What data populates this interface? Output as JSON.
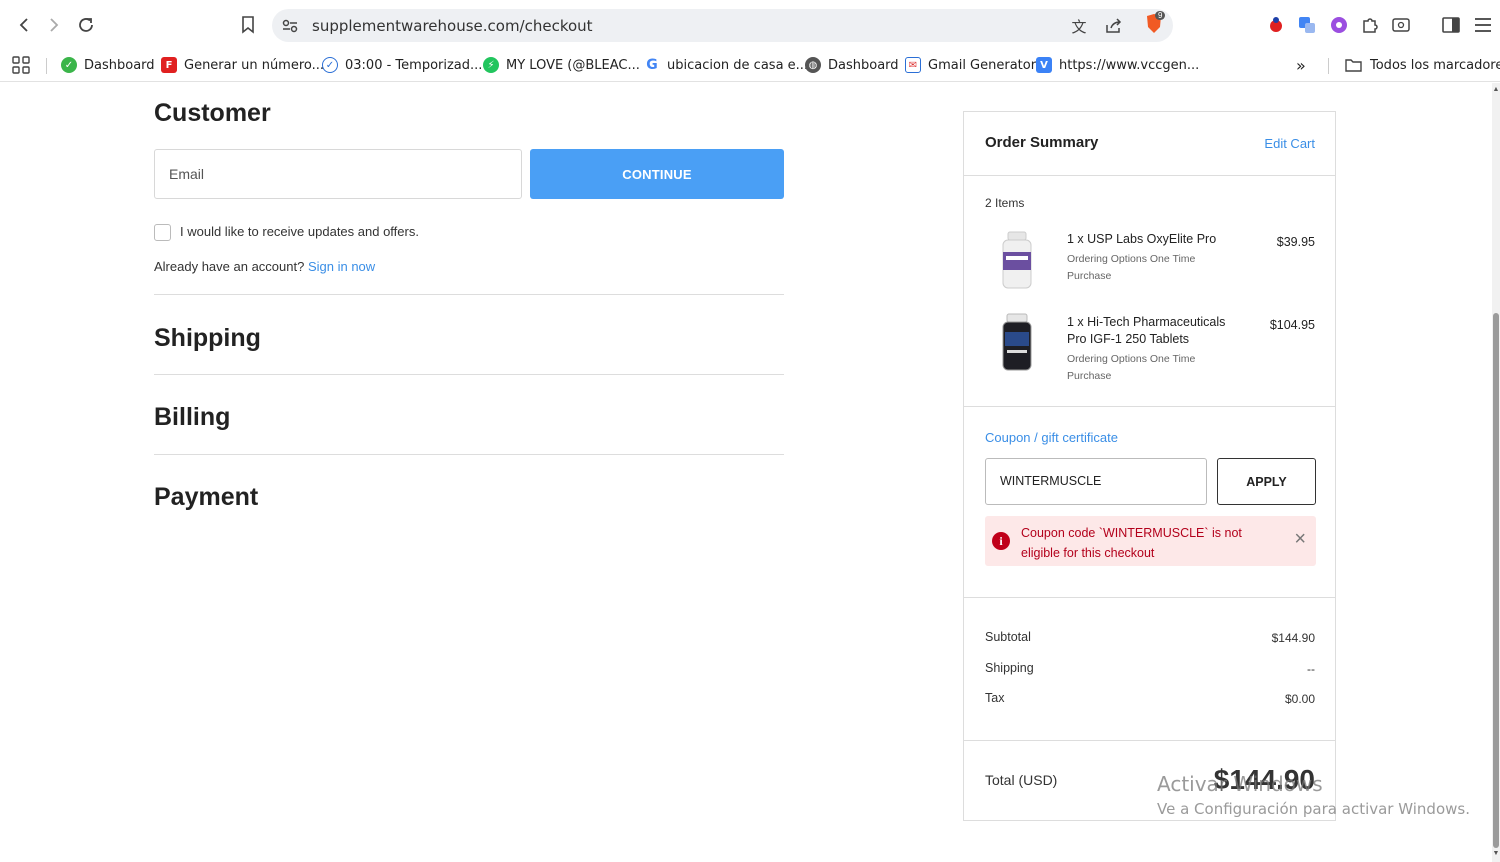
{
  "browser": {
    "url": "supplementwarehouse.com/checkout",
    "bookmarks": [
      {
        "label": "Dashboard",
        "icon": "leaf-icon",
        "color": "#3bb54a"
      },
      {
        "label": "Generar un número...",
        "icon": "f-icon",
        "color": "#e02020"
      },
      {
        "label": "03:00 - Temporizad...",
        "icon": "check-circle-icon",
        "color": "#2b6fd6"
      },
      {
        "label": "MY LOVE (@BLEAC...",
        "icon": "bolt-icon",
        "color": "#22c55e"
      },
      {
        "label": "ubicacion de casa e...",
        "icon": "google-icon",
        "color": "#4285f4"
      },
      {
        "label": "Dashboard",
        "icon": "globe-icon",
        "color": "#555555"
      },
      {
        "label": "Gmail Generator",
        "icon": "mail-icon",
        "color": "#2b6fd6"
      },
      {
        "label": "https://www.vccgen...",
        "icon": "v-icon",
        "color": "#3b82f6"
      }
    ],
    "all_bookmarks": "Todos los marcadores",
    "brave_badge": "9"
  },
  "checkout": {
    "customer_title": "Customer",
    "email_placeholder": "Email",
    "continue_label": "CONTINUE",
    "updates_label": "I would like to receive updates and offers.",
    "already_text": "Already have an account?",
    "signin_label": "Sign in now",
    "shipping_title": "Shipping",
    "billing_title": "Billing",
    "payment_title": "Payment"
  },
  "summary": {
    "title": "Order Summary",
    "edit_cart": "Edit Cart",
    "items_count": "2 Items",
    "items": [
      {
        "name": "1 x USP Labs OxyElite Pro",
        "options": "Ordering Options One Time Purchase",
        "price": "$39.95"
      },
      {
        "name": "1 x Hi-Tech Pharmaceuticals Pro IGF-1 250 Tablets",
        "options": "Ordering Options One Time Purchase",
        "price": "$104.95"
      }
    ],
    "coupon_link": "Coupon / gift certificate",
    "coupon_value": "WINTERMUSCLE",
    "apply_label": "APPLY",
    "alert_text": "Coupon code `WINTERMUSCLE` is not eligible for this checkout",
    "subtotal_label": "Subtotal",
    "subtotal_value": "$144.90",
    "shipping_label": "Shipping",
    "shipping_value": "--",
    "tax_label": "Tax",
    "tax_value": "$0.00",
    "total_label": "Total (USD)",
    "total_value": "$144.90"
  },
  "watermark": {
    "line1": "Activar Windows",
    "line2": "Ve a Configuración para activar Windows."
  }
}
